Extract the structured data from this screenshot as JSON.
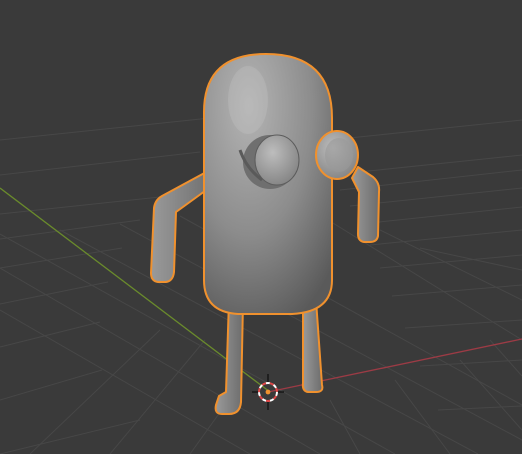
{
  "viewport": {
    "background": "#3a3a3a",
    "grid_color": "#484848",
    "x_axis_color": "#9c3b45",
    "y_axis_color": "#6a8b2c"
  },
  "selected_object": {
    "selected": true,
    "outline_color": "#f0912e",
    "surface_color": "#8e8e8e"
  },
  "cursor_3d": {
    "icon": "3d-cursor-icon",
    "ring_colors": [
      "#e04848",
      "#ffffff"
    ]
  }
}
